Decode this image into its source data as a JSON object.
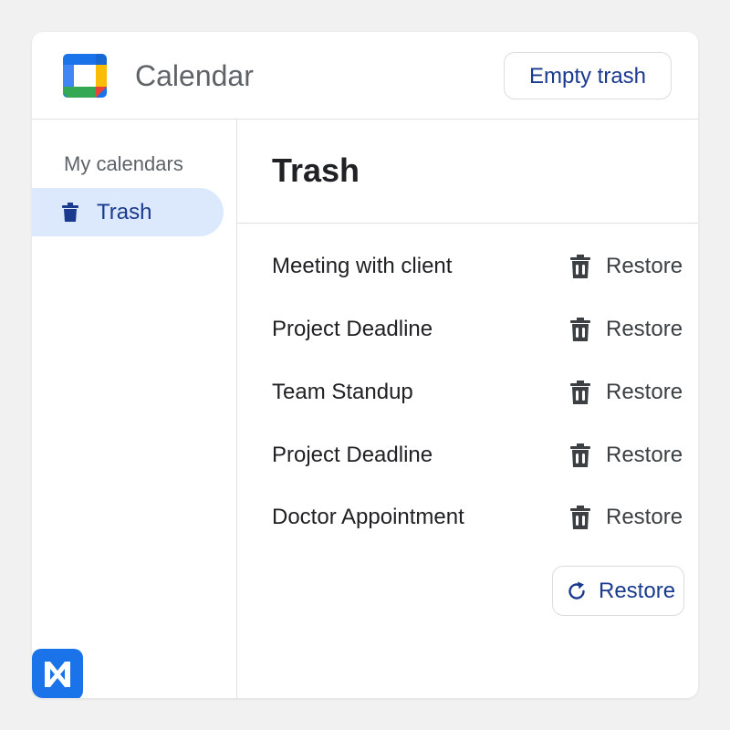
{
  "header": {
    "app_title": "Calendar",
    "empty_trash_label": "Empty trash",
    "logo_icon": "google-calendar-logo-icon"
  },
  "sidebar": {
    "heading": "My calendars",
    "items": [
      {
        "label": "Trash",
        "icon": "trash-icon",
        "selected": true
      }
    ]
  },
  "main": {
    "title": "Trash",
    "rows": [
      {
        "title": "Meeting with client",
        "action_label": "Restore"
      },
      {
        "title": "Project Deadline",
        "action_label": "Restore"
      },
      {
        "title": "Team Standup",
        "action_label": "Restore"
      },
      {
        "title": "Project Deadline",
        "action_label": "Restore"
      },
      {
        "title": "Doctor Appointment",
        "action_label": "Restore"
      }
    ],
    "restore_button_label": "Restore"
  },
  "colors": {
    "accent": "#1a3a8f",
    "selected_bg": "#dce8fb",
    "badge_blue": "#1a73e8"
  },
  "badge": {
    "icon": "app-logo-icon"
  }
}
